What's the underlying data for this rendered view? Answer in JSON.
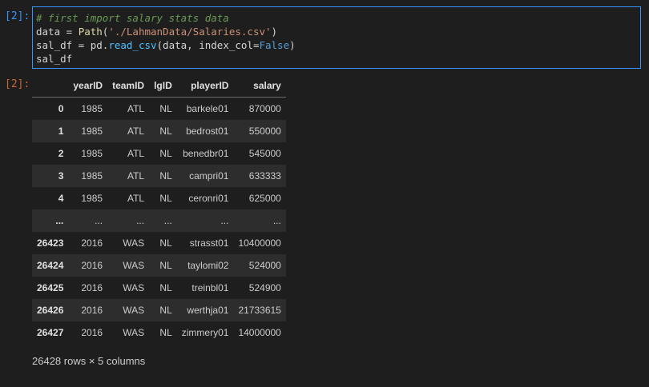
{
  "input_cell": {
    "prompt": "[2]:",
    "code_lines": [
      "# first import salary stats data",
      "data = Path('./LahmanData/Salaries.csv')",
      "sal_df = pd.read_csv(data, index_col=False)",
      "sal_df"
    ]
  },
  "output_cell": {
    "prompt": "[2]:",
    "columns": [
      "",
      "yearID",
      "teamID",
      "lgID",
      "playerID",
      "salary"
    ],
    "rows": [
      [
        "0",
        "1985",
        "ATL",
        "NL",
        "barkele01",
        "870000"
      ],
      [
        "1",
        "1985",
        "ATL",
        "NL",
        "bedrost01",
        "550000"
      ],
      [
        "2",
        "1985",
        "ATL",
        "NL",
        "benedbr01",
        "545000"
      ],
      [
        "3",
        "1985",
        "ATL",
        "NL",
        "campri01",
        "633333"
      ],
      [
        "4",
        "1985",
        "ATL",
        "NL",
        "ceronri01",
        "625000"
      ],
      [
        "...",
        "...",
        "...",
        "...",
        "...",
        "..."
      ],
      [
        "26423",
        "2016",
        "WAS",
        "NL",
        "strasst01",
        "10400000"
      ],
      [
        "26424",
        "2016",
        "WAS",
        "NL",
        "taylomi02",
        "524000"
      ],
      [
        "26425",
        "2016",
        "WAS",
        "NL",
        "treinbl01",
        "524900"
      ],
      [
        "26426",
        "2016",
        "WAS",
        "NL",
        "werthja01",
        "21733615"
      ],
      [
        "26427",
        "2016",
        "WAS",
        "NL",
        "zimmery01",
        "14000000"
      ]
    ],
    "shape_text": "26428 rows × 5 columns"
  },
  "colors": {
    "background": "#1e1e1e",
    "cell_border": "#3794ff",
    "input_prompt": "#3794ff",
    "output_prompt": "#cc6633",
    "striped_row": "#2d2d2d"
  }
}
